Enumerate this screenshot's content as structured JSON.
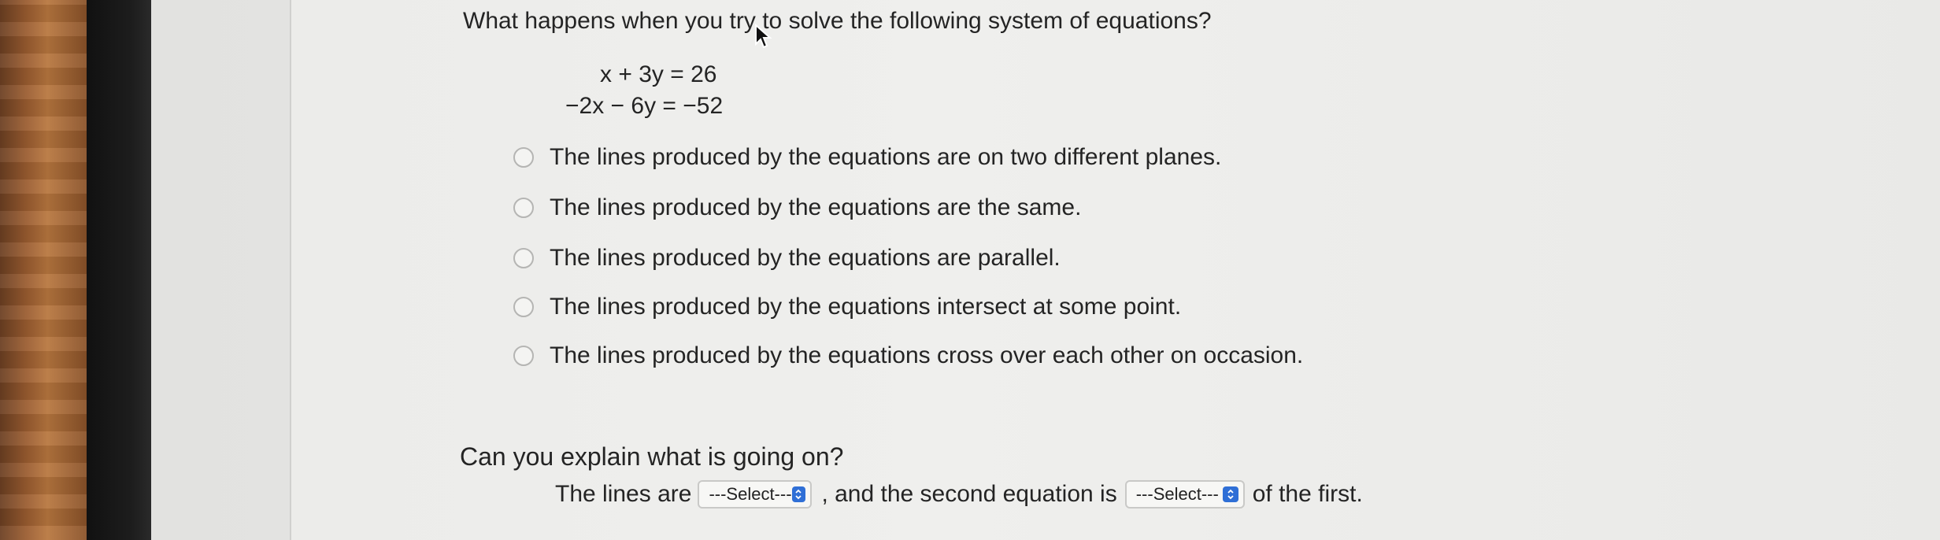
{
  "question": {
    "prompt": "What happens when you try to solve the following system of equations?",
    "equation_1": "x + 3y =   26",
    "equation_2": "−2x − 6y = −52"
  },
  "choices": [
    {
      "label": "The lines produced by the equations are on two different planes."
    },
    {
      "label": "The lines produced by the equations are the same."
    },
    {
      "label": "The lines produced by the equations are parallel."
    },
    {
      "label": "The lines produced by the equations intersect at some point."
    },
    {
      "label": "The lines produced by the equations cross over each other on occasion."
    }
  ],
  "explain": {
    "prompt": "Can you explain what is going on?",
    "part1": "The lines are",
    "select1_value": "---Select---",
    "part2": ", and the second equation is",
    "select2_value": "---Select---",
    "part3": "of the first."
  },
  "colors": {
    "select_arrow": "#2f6fd6",
    "text": "#242424"
  },
  "icons": {
    "cursor": "arrow-cursor-icon",
    "select_arrow": "chevron-updown-icon"
  }
}
